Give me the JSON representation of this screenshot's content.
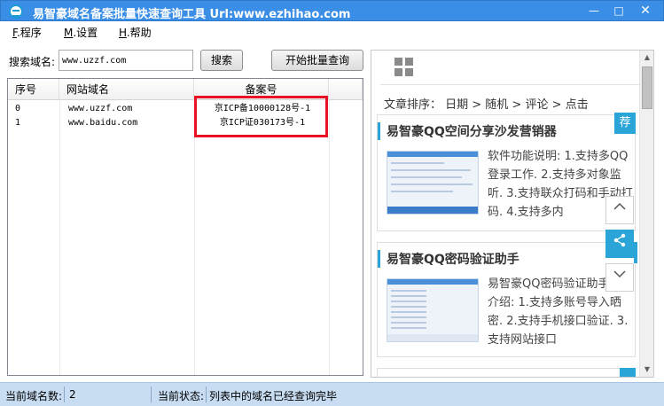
{
  "window": {
    "title": "易智豪域名备案批量快速查询工具 Url:www.ezhihao.com",
    "min_glyph": "—",
    "max_glyph": "□",
    "close_glyph": "✕"
  },
  "menu": {
    "items": [
      {
        "key": "F",
        "label": ".程序"
      },
      {
        "key": "M",
        "label": ".设置"
      },
      {
        "key": "H",
        "label": ".帮助"
      }
    ]
  },
  "search": {
    "label": "搜索域名:",
    "value": "www.uzzf.com",
    "search_button": "搜索",
    "batch_button": "开始批量查询"
  },
  "table": {
    "headers": [
      "序号",
      "网站域名",
      "备案号"
    ],
    "rows": [
      {
        "index": "0",
        "domain": "www.uzzf.com",
        "icp": "京ICP备10000128号-1"
      },
      {
        "index": "1",
        "domain": "www.baidu.com",
        "icp": "京ICP证030173号-1"
      }
    ]
  },
  "right_panel": {
    "sort_text": "文章排序： 日期 > 随机 > 评论 > 点击",
    "recommend_tag": "荐",
    "cards": [
      {
        "title": "易智豪QQ空间分享沙发营销器",
        "desc": "软件功能说明: 1.支持多QQ登录工作. 2.支持多对象监听. 3.支持联众打码和手动打码. 4.支持多内"
      },
      {
        "title": "易智豪QQ密码验证助手",
        "desc": "易智豪QQ密码验证助手功能介绍: 1.支持多账号导入晒密. 2.支持手机接口验证. 3.支持网站接口"
      }
    ]
  },
  "status": {
    "count_label": "当前域名数:",
    "count_value": "2",
    "state_label": "当前状态:",
    "state_value": "列表中的域名已经查询完毕"
  },
  "colors": {
    "titlebar": "#3a8ee6",
    "accent": "#2ba4d8",
    "highlight_box": "#e81224",
    "statusbar": "#c8dcf2"
  }
}
